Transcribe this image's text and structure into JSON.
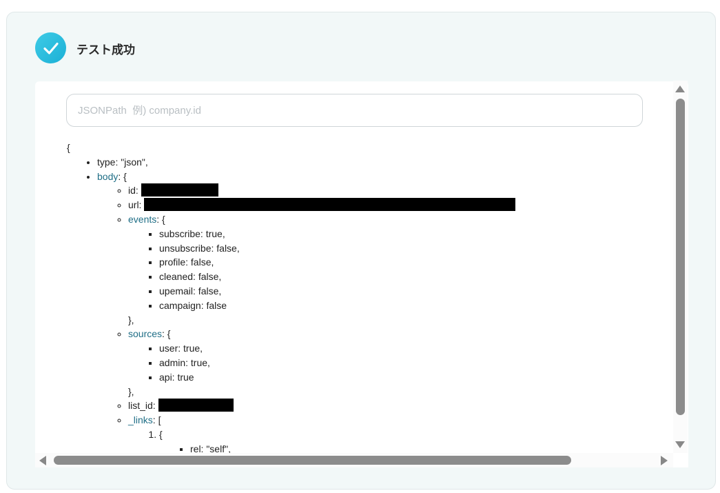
{
  "header": {
    "title": "テスト成功",
    "icon": "check-circle-icon",
    "icon_color": "#1bb0d6"
  },
  "search": {
    "placeholder": "JSONPath  例) company.id",
    "value": ""
  },
  "json_tree": {
    "open_brace": "{",
    "type_line": "type: \"json\",",
    "body_key": "body",
    "body_open": ": {",
    "id_label": "id:",
    "url_label": "url:",
    "events_key": "events",
    "events_open": ": {",
    "events": [
      "subscribe: true,",
      "unsubscribe: false,",
      "profile: false,",
      "cleaned: false,",
      "upemail: false,",
      "campaign: false"
    ],
    "events_close": "},",
    "sources_key": "sources",
    "sources_open": ": {",
    "sources": [
      "user: true,",
      "admin: true,",
      "api: true"
    ],
    "sources_close": "},",
    "list_id_label": "list_id:",
    "links_key": "_links",
    "links_open": ": [",
    "link_item_open": "{",
    "rel_line": "rel: \"self\","
  },
  "colors": {
    "link_key": "#1f6e86",
    "card_bg": "#f2f8f8"
  }
}
